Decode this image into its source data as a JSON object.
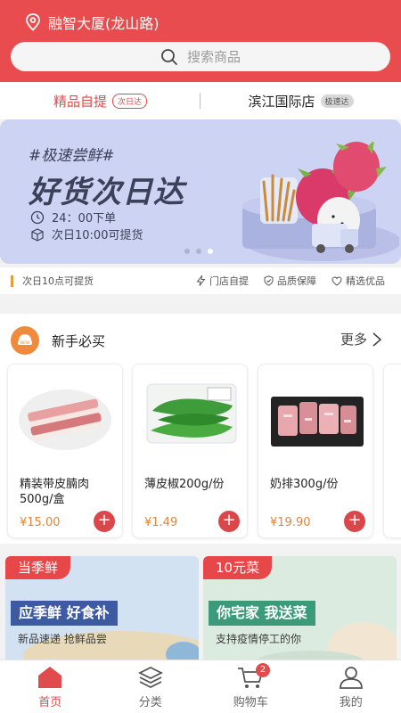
{
  "header": {
    "location": "融智大厦(龙山路)",
    "search_placeholder": "搜索商品"
  },
  "stores": [
    {
      "name": "精品自提",
      "tag": "次日达",
      "active": true
    },
    {
      "name": "滨江国际店",
      "tag": "极速达",
      "active": false
    }
  ],
  "banner": {
    "subtitle": "#极速尝鲜#",
    "title": "好货次日达",
    "line1": "24：00下单",
    "line2": "次日10:00可提货",
    "slides": 3,
    "active_slide": 3
  },
  "features": {
    "left": "次日10点可提货",
    "items": [
      "门店自提",
      "品质保障",
      "精选优品"
    ]
  },
  "new_user": {
    "title": "新手必买",
    "more": "更多",
    "products": [
      {
        "name": "精装带皮腩肉500g/盒",
        "price": "¥15.00"
      },
      {
        "name": "薄皮椒200g/份",
        "price": "¥1.49"
      },
      {
        "name": "奶排300g/份",
        "price": "¥19.90"
      }
    ]
  },
  "promos": [
    {
      "tag": "当季鲜",
      "headline": "应季鲜 好食补",
      "sub": "新品速递 抢鲜品尝",
      "color": "#3d5aa3"
    },
    {
      "tag": "10元菜",
      "headline": "你宅家 我送菜",
      "sub": "支持疫情停工的你",
      "color": "#3a9a7a"
    }
  ],
  "tabbar": {
    "items": [
      "首页",
      "分类",
      "购物车",
      "我的"
    ],
    "cart_badge": "2"
  },
  "colors": {
    "brand": "#e84c4f",
    "price": "#e0853b"
  }
}
